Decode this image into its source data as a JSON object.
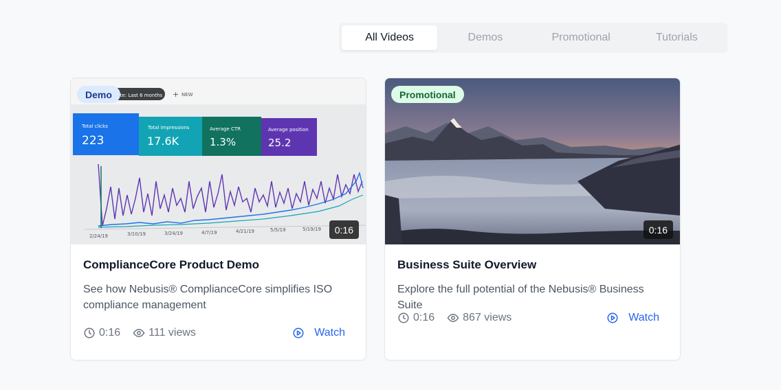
{
  "tabs": [
    {
      "label": "All Videos",
      "active": true
    },
    {
      "label": "Demos",
      "active": false
    },
    {
      "label": "Promotional",
      "active": false
    },
    {
      "label": "Tutorials",
      "active": false
    }
  ],
  "videos": [
    {
      "badge": "Demo",
      "duration": "0:16",
      "title": "ComplianceCore Product Demo",
      "description": "See how Nebusis® ComplianceCore simplifies ISO compliance management",
      "meta_duration": "0:16",
      "views": "111 views",
      "watch_label": "Watch",
      "thumbnail": {
        "header_chip": "Date: Last 6 months",
        "new_label": "NEW",
        "stats": [
          {
            "label": "Total clicks",
            "value": "223"
          },
          {
            "label": "Total impressions",
            "value": "17.6K"
          },
          {
            "label": "Average CTR",
            "value": "1.3%"
          },
          {
            "label": "Average position",
            "value": "25.2"
          }
        ],
        "dates": [
          "2/24/19",
          "3/10/19",
          "3/24/19",
          "4/7/19",
          "4/21/19",
          "5/5/19",
          "5/19/19"
        ]
      }
    },
    {
      "badge": "Promotional",
      "duration": "0:16",
      "title": "Business Suite Overview",
      "description": "Explore the full potential of the Nebusis® Business Suite",
      "meta_duration": "0:16",
      "views": "867 views",
      "watch_label": "Watch"
    }
  ],
  "colors": {
    "accent": "#2563eb",
    "demo_badge_bg": "#dbeafe",
    "promo_badge_bg": "#dcfce7"
  }
}
